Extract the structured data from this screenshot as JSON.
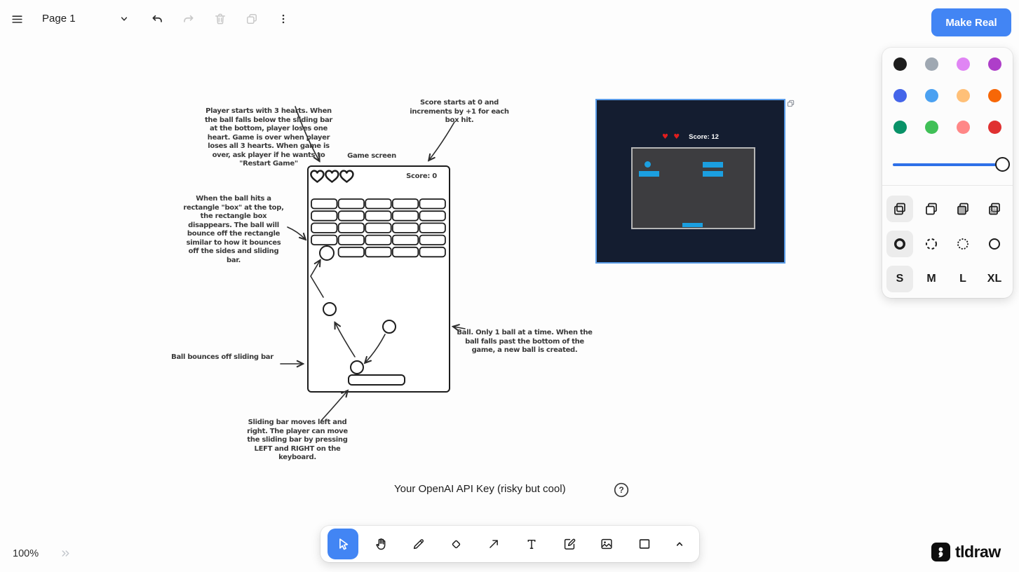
{
  "topbar": {
    "page_name": "Page 1",
    "make_real_label": "Make Real"
  },
  "style_panel": {
    "colors": [
      {
        "name": "black",
        "hex": "#1d1d1d"
      },
      {
        "name": "grey",
        "hex": "#9fa8b2"
      },
      {
        "name": "light-violet",
        "hex": "#e085f4"
      },
      {
        "name": "violet",
        "hex": "#ae3ec9"
      },
      {
        "name": "blue",
        "hex": "#4465e9"
      },
      {
        "name": "light-blue",
        "hex": "#4ba1f1"
      },
      {
        "name": "yellow",
        "hex": "#ffc078"
      },
      {
        "name": "orange",
        "hex": "#f76707"
      },
      {
        "name": "green",
        "hex": "#099268"
      },
      {
        "name": "light-green",
        "hex": "#40c057"
      },
      {
        "name": "light-red",
        "hex": "#ff8787"
      },
      {
        "name": "red",
        "hex": "#e03131"
      }
    ],
    "opacity_slider": {
      "value_percent": 100,
      "track_color": "#2e70e8"
    },
    "sizes": [
      "S",
      "M",
      "L",
      "XL"
    ],
    "selected_size": "S"
  },
  "sketch": {
    "notes": {
      "hearts": "Player starts with 3 hearts. When\nthe ball falls below the sliding bar\nat the bottom, player loses one\nheart. Game is over when player\nloses all 3 hearts. When game is\nover, ask player if he wants to\n\"Restart Game\"",
      "score": "Score starts at 0 and\nincrements by +1 for each\nbox hit.",
      "game_screen_label": "Game screen",
      "boxes": "When the ball hits a\nrectangle \"box\" at the top,\nthe rectangle box\ndisappears. The ball will\nbounce off the rectangle\nsimilar to how it bounces\noff the sides and sliding\nbar.",
      "bounce": "Ball bounces off sliding bar",
      "ball": "Ball. Only 1 ball at a time. When the\nball falls past the bottom of the\ngame, a new ball is created.",
      "slider": "Sliding bar moves left and\nright. The player can move\nthe sliding bar by pressing\nLEFT and RIGHT on the\nkeyboard."
    },
    "score_label": "Score: 0"
  },
  "preview": {
    "hearts": "♥ ♥",
    "score_label": "Score: 12",
    "background": "#141d30",
    "accent": "#1b9fe0"
  },
  "footer": {
    "api_key_label": "Your OpenAI API Key (risky but cool)",
    "help_label": "?"
  },
  "statusbar": {
    "zoom_level": "100%"
  },
  "brand": {
    "logo_text": "tldraw"
  }
}
